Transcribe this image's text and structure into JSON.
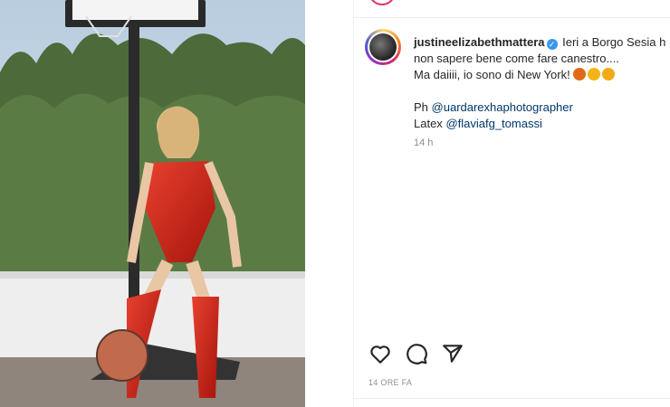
{
  "post": {
    "username": "justineelizabethmattera",
    "caption_line1": "Ieri a Borgo Sesia h",
    "caption_line2": "non sapere bene come fare canestro....",
    "caption_line3": "Ma daiiii, io sono di New York!",
    "credit_ph_label": "Ph",
    "credit_ph_handle": "@uardarexhaphotographer",
    "credit_latex_label": "Latex",
    "credit_latex_handle": "@flaviafg_tomassi",
    "relative_time": "14 h",
    "date": "14 ORE FA"
  },
  "icons": {
    "verified": "verified-badge-icon",
    "like": "heart-icon",
    "comment": "comment-icon",
    "share": "paper-plane-icon",
    "emojis": [
      "basketball-emoji",
      "tongue-out-emoji",
      "squinting-tongue-emoji"
    ]
  },
  "colors": {
    "link": "#00376b",
    "verified": "#3897f0",
    "text": "#262626",
    "muted": "#8e8e8e"
  }
}
